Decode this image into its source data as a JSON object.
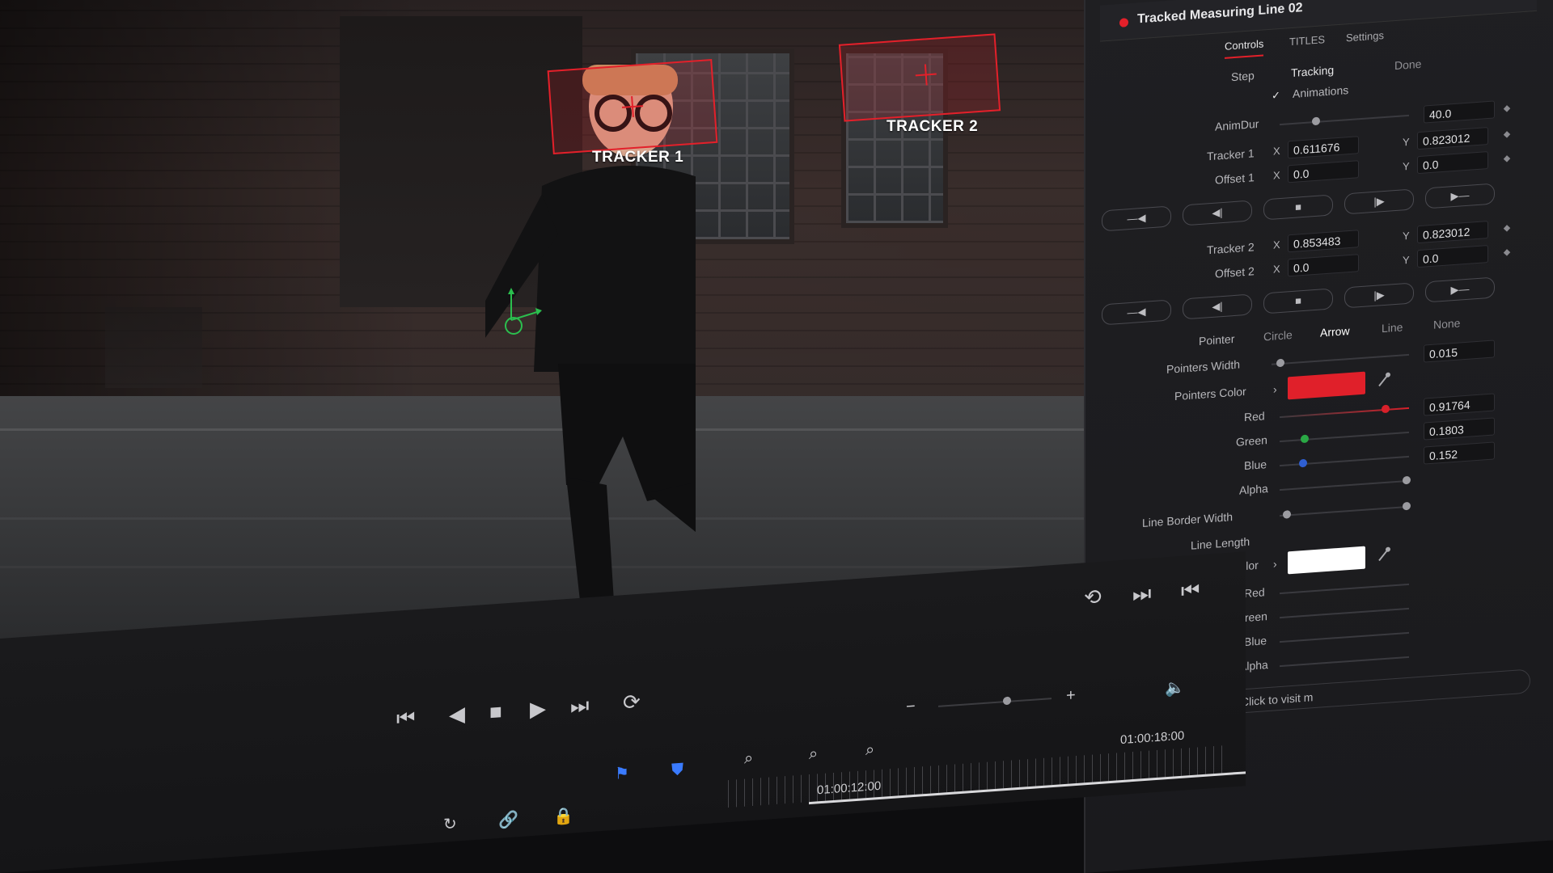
{
  "inspector": {
    "title": "Tracked Measuring Line 02",
    "tabs": [
      "Controls",
      "TITLES",
      "Settings"
    ],
    "active_tab": "Controls",
    "mode_step": "Step",
    "mode_tracking": "Tracking",
    "done": "Done",
    "animations_label": "Animations",
    "animations_checked": true,
    "anim_dur_label": "AnimDur",
    "anim_dur_value": "40.0",
    "tracker1": {
      "label": "Tracker 1",
      "x_axis": "X",
      "x": "0.611676",
      "y_axis": "Y",
      "y": "0.823012"
    },
    "offset1": {
      "label": "Offset 1",
      "x_axis": "X",
      "x": "0.0",
      "y_axis": "Y",
      "y": "0.0"
    },
    "tracker2": {
      "label": "Tracker 2",
      "x_axis": "X",
      "x": "0.853483",
      "y_axis": "Y",
      "y": "0.823012"
    },
    "offset2": {
      "label": "Offset 2",
      "x_axis": "X",
      "x": "0.0",
      "y_axis": "Y",
      "y": "0.0"
    },
    "pointer": {
      "label": "Pointer",
      "options": [
        "Circle",
        "Arrow",
        "Line",
        "None"
      ],
      "selected": "Arrow"
    },
    "pointers_width": {
      "label": "Pointers Width",
      "value": "0.015"
    },
    "pointers_color": {
      "label": "Pointers Color",
      "swatch": "#e0202a",
      "red_label": "Red",
      "red": "0.91764",
      "green_label": "Green",
      "green": "0.1803",
      "blue_label": "Blue",
      "blue": "0.152",
      "alpha_label": "Alpha"
    },
    "line_border_width": {
      "label": "Line Border Width"
    },
    "line_length": {
      "label": "Line Length"
    },
    "line_color": {
      "label": "Line Color",
      "swatch": "#ffffff",
      "red_label": "Red",
      "green_label": "Green",
      "blue_label": "Blue",
      "alpha_label": "Alpha"
    },
    "credit": "Made by LLmotion. Click to visit m"
  },
  "viewer": {
    "tracker1_label": "TRACKER 1",
    "tracker2_label": "TRACKER 2",
    "accent": "#e3202a"
  },
  "timeline": {
    "timecode_a": "01:00:18:00",
    "timecode_b": "01:00:12:00"
  },
  "icons": [
    "skip-to-start-icon",
    "step-back-icon",
    "stop-icon",
    "play-icon",
    "skip-to-end-icon",
    "loop-icon",
    "flag-marker-icon",
    "shield-marker-icon",
    "zoom-detail-icon",
    "zoom-fit-icon",
    "zoom-custom-icon",
    "volume-icon",
    "snap-icon",
    "link-icon",
    "lock-icon",
    "eyedropper-icon",
    "loop-view-icon",
    "next-frame-icon",
    "prev-frame-icon"
  ]
}
